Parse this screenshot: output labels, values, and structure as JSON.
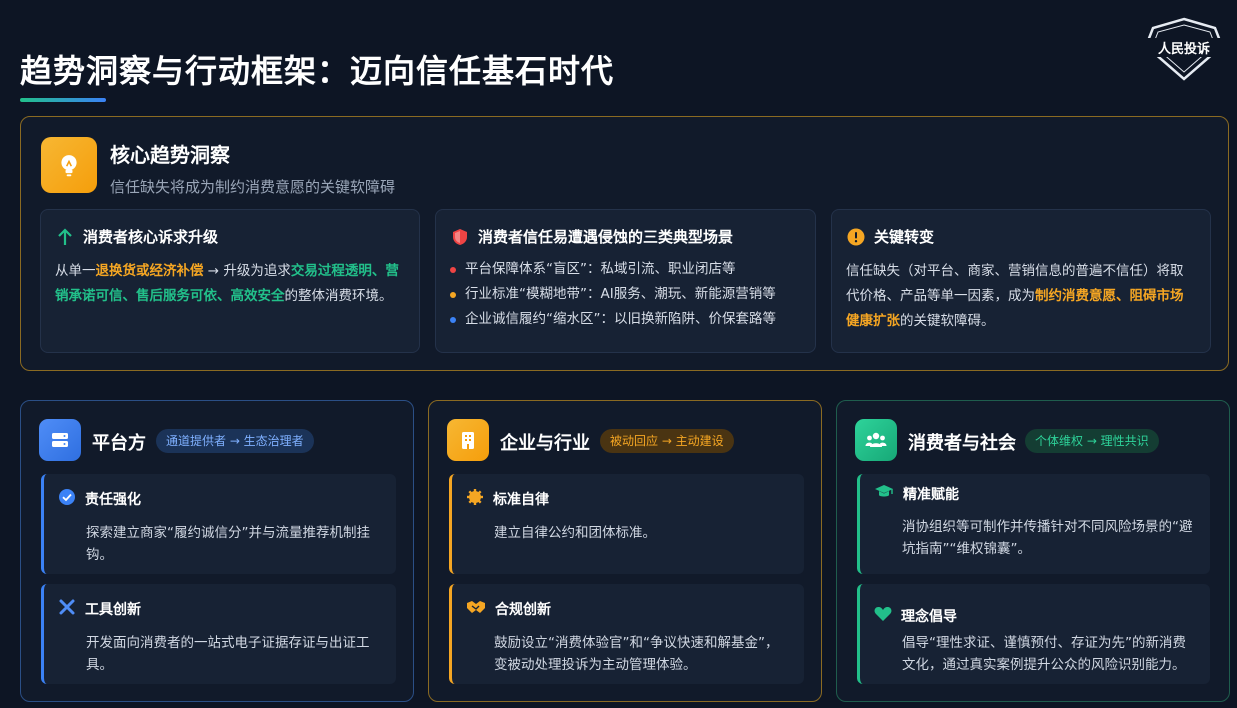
{
  "page": {
    "title": "趋势洞察与行动框架：迈向信任基石时代",
    "logo_text": "人民投诉"
  },
  "trend": {
    "title": "核心趋势洞察",
    "subtitle": "信任缺失将成为制约消费意愿的关键软障碍",
    "cards": {
      "upgrade": {
        "title": "消费者核心诉求升级",
        "t1": "从单一",
        "h1": "退换货或经济补偿",
        "t2": " → 升级为追求",
        "h2": "交易过程透明、营销承诺可信、售后服务可依、高效安全",
        "t3": "的整体消费环境。"
      },
      "scenes": {
        "title": "消费者信任易遭遇侵蚀的三类典型场景",
        "items": [
          {
            "text": "平台保障体系“盲区”：私域引流、职业闭店等",
            "color": "#ef4444"
          },
          {
            "text": "行业标准“模糊地带”：AI服务、潮玩、新能源营销等",
            "color": "#f5a623"
          },
          {
            "text": "企业诚信履约“缩水区”：以旧换新陷阱、价保套路等",
            "color": "#3b82f6"
          }
        ]
      },
      "shift": {
        "title": "关键转变",
        "t1": "信任缺失（对平台、商家、营销信息的普遍不信任）将取代价格、产品等单一因素，成为",
        "h1": "制约消费意愿、阻碍市场健康扩张",
        "t2": "的关键软障碍。"
      }
    }
  },
  "panels": {
    "platform": {
      "title": "平台方",
      "tag": "通道提供者 → 生态治理者",
      "items": [
        {
          "title": "责任强化",
          "body": "探索建立商家“履约诚信分”并与流量推荐机制挂钩。"
        },
        {
          "title": "工具创新",
          "body": "开发面向消费者的一站式电子证据存证与出证工具。"
        }
      ]
    },
    "enterprise": {
      "title": "企业与行业",
      "tag": "被动回应 → 主动建设",
      "items": [
        {
          "title": "标准自律",
          "body": "建立自律公约和团体标准。"
        },
        {
          "title": "合规创新",
          "body": "鼓励设立“消费体验官”和“争议快速和解基金”，变被动处理投诉为主动管理体验。"
        }
      ]
    },
    "society": {
      "title": "消费者与社会",
      "tag": "个体维权 → 理性共识",
      "items": [
        {
          "title": "精准赋能",
          "body": "消协组织等可制作并传播针对不同风险场景的“避坑指南”“维权锦囊”。"
        },
        {
          "title": "理念倡导",
          "body": "倡导“理性求证、谨慎预付、存证为先”的新消费文化，通过真实案例提升公众的风险识别能力。"
        }
      ]
    }
  },
  "colors": {
    "amber": "#f5a623",
    "blue": "#3b82f6",
    "green": "#22c08a",
    "red": "#ef4444"
  }
}
